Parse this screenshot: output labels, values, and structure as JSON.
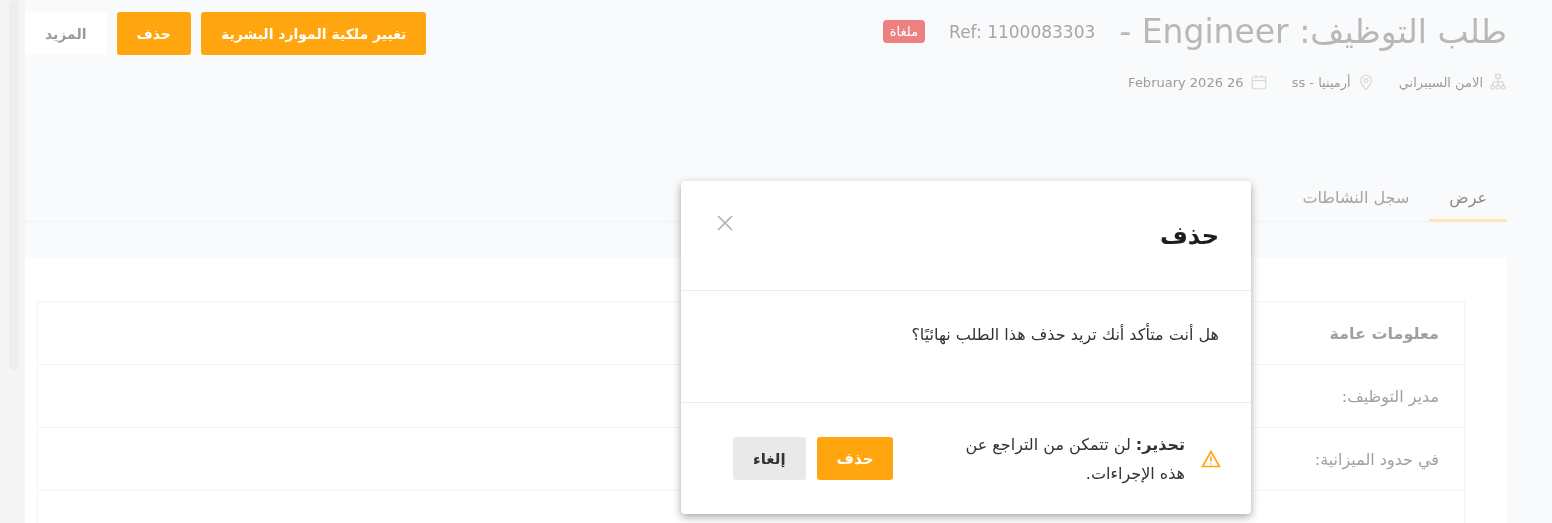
{
  "header": {
    "title": "طلب التوظيف: Engineer -",
    "reference": "Ref: 1100083303",
    "status_badge": "ملغاة",
    "meta": [
      {
        "kind": "department",
        "text": "الامن السيبراني"
      },
      {
        "kind": "location",
        "text": "أرمينيا - ss"
      },
      {
        "kind": "date",
        "text": "26 February 2026"
      }
    ]
  },
  "actions": [
    {
      "kind": "primary",
      "label": "تغيير ملكية الموارد البشرية"
    },
    {
      "kind": "primary",
      "label": "حذف"
    },
    {
      "kind": "secondary",
      "label": "المزيد"
    }
  ],
  "tabs": [
    {
      "label": "عرض",
      "selected": true
    },
    {
      "label": "سجل النشاطات",
      "selected": false
    }
  ],
  "info_card": {
    "title": "معلومات عامة",
    "rows": [
      "مدير التوظيف:",
      "في حدود الميزانية:"
    ]
  },
  "dialog": {
    "title": "حذف",
    "message": "هل أنت متأكد أنك تريد حذف هذا الطلب نهائيًا؟",
    "warning": "**تحذير:** لن تتمكن من التراجع عن هذه الإجراءات.",
    "buttons": [
      {
        "kind": "danger",
        "label": "حذف"
      },
      {
        "kind": "cancel",
        "label": "إلغاء"
      }
    ]
  }
}
